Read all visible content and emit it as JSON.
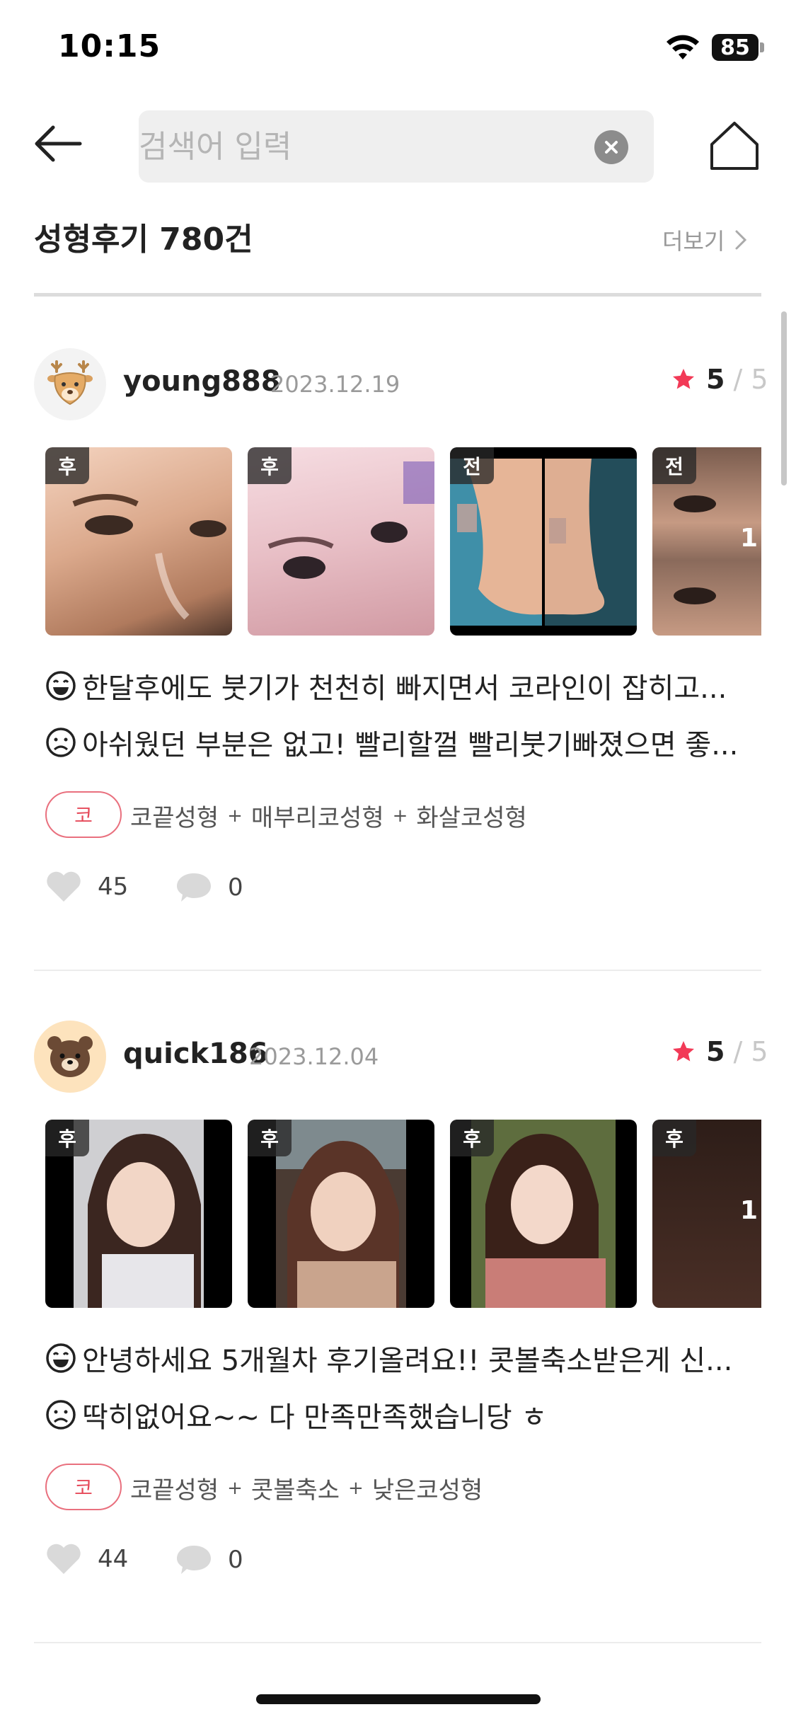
{
  "status_bar": {
    "time": "10:15",
    "battery": "85"
  },
  "header": {
    "search_placeholder": "검색어 입력"
  },
  "section": {
    "title": "성형후기 780건",
    "more_label": "더보기"
  },
  "reviews": [
    {
      "username": "young888",
      "date": "2023.12.19",
      "rating": "5",
      "rating_max": "/ 5",
      "avatar": "deer-avatar",
      "photos": [
        {
          "tag": "후",
          "count": ""
        },
        {
          "tag": "후",
          "count": ""
        },
        {
          "tag": "전",
          "count": ""
        },
        {
          "tag": "전",
          "count": "1"
        }
      ],
      "good_text": "한달후에도 붓기가 천천히 빠지면서 코라인이 잡히고...",
      "bad_text": "아쉬웠던 부분은 없고! 빨리할껄 빨리붓기빠졌으면 좋...",
      "category": "코",
      "procedures": [
        "코끝성형",
        "매부리코성형",
        "화살코성형"
      ],
      "likes": "45",
      "comments": "0"
    },
    {
      "username": "quick186",
      "date": "2023.12.04",
      "rating": "5",
      "rating_max": "/ 5",
      "avatar": "bear-avatar",
      "photos": [
        {
          "tag": "후",
          "count": ""
        },
        {
          "tag": "후",
          "count": ""
        },
        {
          "tag": "후",
          "count": ""
        },
        {
          "tag": "후",
          "count": "1"
        }
      ],
      "good_text": "안녕하세요 5개월차 후기올려요!! 콧볼축소받은게 신...",
      "bad_text": "딱히없어요~~ 다 만족만족했습니당 ㅎ",
      "category": "코",
      "procedures": [
        "코끝성형",
        "콧볼축소",
        "낮은코성형"
      ],
      "likes": "44",
      "comments": "0"
    }
  ],
  "colors": {
    "accent": "#e64a5a",
    "star": "#f23a57",
    "divider": "#dcdcdc"
  }
}
